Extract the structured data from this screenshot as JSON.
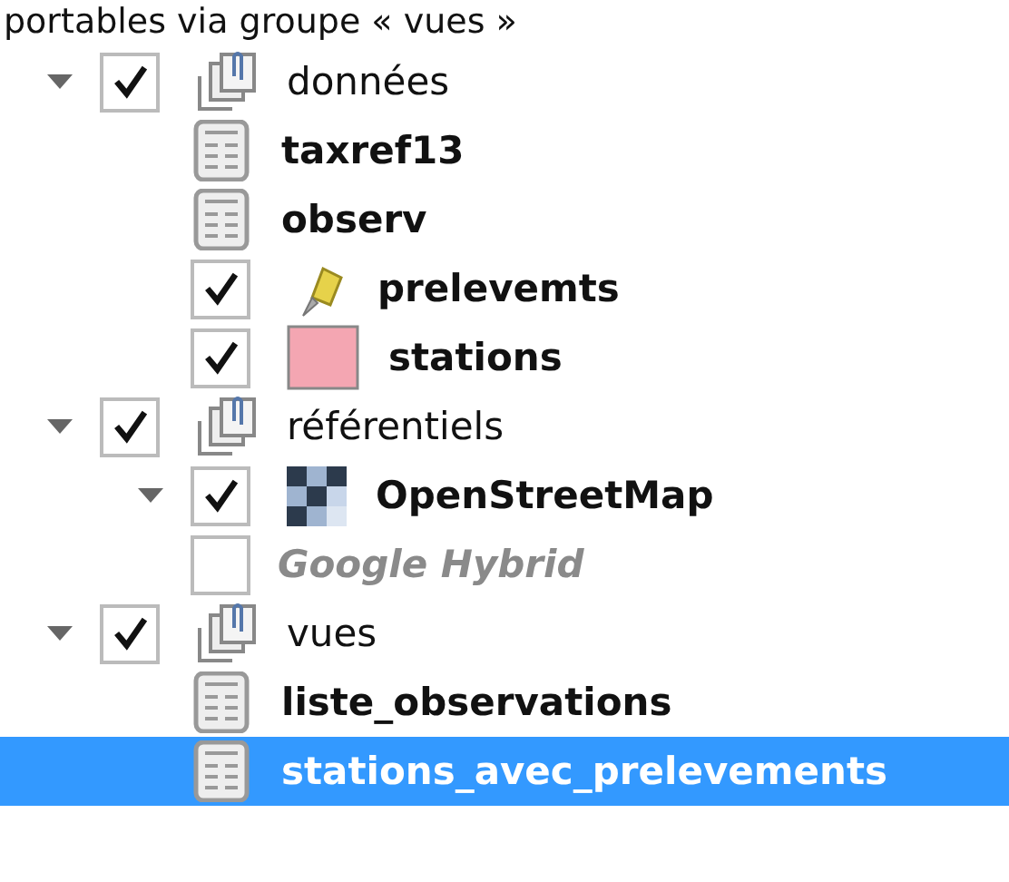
{
  "header_text": "portables via groupe « vues »",
  "tree": [
    {
      "kind": "group",
      "label": "données",
      "expanded": true,
      "checked": true,
      "selected": false,
      "children": [
        {
          "kind": "table",
          "label": "taxref13",
          "disabled": false,
          "selected": false
        },
        {
          "kind": "table",
          "label": "observ",
          "disabled": false,
          "selected": false
        },
        {
          "kind": "point",
          "label": "prelevemts",
          "checked": true,
          "disabled": false,
          "selected": false
        },
        {
          "kind": "polygon",
          "label": "stations",
          "checked": true,
          "disabled": false,
          "selected": false
        }
      ]
    },
    {
      "kind": "group",
      "label": "référentiels",
      "expanded": true,
      "checked": true,
      "selected": false,
      "children": [
        {
          "kind": "raster",
          "label": "OpenStreetMap",
          "expanded": true,
          "checked": true,
          "disabled": false,
          "selected": false
        },
        {
          "kind": "layer",
          "label": "Google Hybrid",
          "checked": false,
          "disabled": true,
          "selected": false
        }
      ]
    },
    {
      "kind": "group",
      "label": "vues",
      "expanded": true,
      "checked": true,
      "selected": false,
      "children": [
        {
          "kind": "table",
          "label": "liste_observations",
          "disabled": false,
          "selected": false
        },
        {
          "kind": "table",
          "label": "stations_avec_prelevements",
          "disabled": false,
          "selected": true
        }
      ]
    }
  ]
}
